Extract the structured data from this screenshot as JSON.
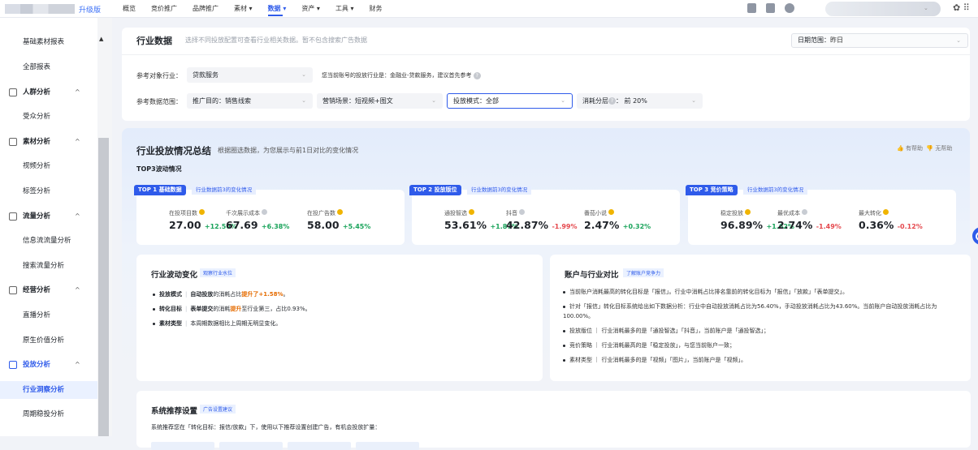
{
  "header": {
    "upgrade_label": "升级版",
    "nav": [
      "概览",
      "竞价推广",
      "品牌推广",
      "素材 ▾",
      "数据 ▾",
      "资产 ▾",
      "工具 ▾",
      "财务"
    ],
    "active_nav_index": 4,
    "dropdown_caret": "▾",
    "settings_glyph": "✿ ⠿"
  },
  "sidebar": {
    "collapse_caret": "▲",
    "group_caret": "^",
    "items": [
      {
        "type": "item",
        "label": "基础素材报表"
      },
      {
        "type": "item",
        "label": "全部报表"
      },
      {
        "type": "group",
        "label": "人群分析",
        "icon": "people-icon"
      },
      {
        "type": "item",
        "label": "受众分析"
      },
      {
        "type": "group",
        "label": "素材分析",
        "icon": "image-icon"
      },
      {
        "type": "item",
        "label": "视频分析"
      },
      {
        "type": "item",
        "label": "标签分析"
      },
      {
        "type": "group",
        "label": "流量分析",
        "icon": "flow-icon"
      },
      {
        "type": "item",
        "label": "信息流流量分析"
      },
      {
        "type": "item",
        "label": "搜索流量分析"
      },
      {
        "type": "group",
        "label": "经营分析",
        "icon": "chart-icon"
      },
      {
        "type": "item",
        "label": "直播分析"
      },
      {
        "type": "item",
        "label": "原生价值分析"
      },
      {
        "type": "group",
        "label": "投放分析",
        "icon": "delivery-icon",
        "active": true
      },
      {
        "type": "item",
        "label": "行业洞察分析",
        "active": true
      },
      {
        "type": "item",
        "label": "周期稳投分析"
      }
    ]
  },
  "industry": {
    "title": "行业数据",
    "subtitle": "选择不同投放配置可查看行业相关数据。暂不包含搜索广告数据",
    "date_label": "日期范围：",
    "date_value": "昨日",
    "ref_industry_label": "参考对象行业：",
    "ref_industry_value": "贷款服务",
    "ref_note": "您当前账号的投放行业是：金融业-贷款服务，建议首先参考",
    "scope_label": "参考数据范围：",
    "goal_label": "推广目的：",
    "goal_value": "销售线索",
    "scene_label": "营销场景：",
    "scene_value": "短视频+图文",
    "mode_label": "投放模式：",
    "mode_value": "全部",
    "tier_label": "消耗分层",
    "tier_value": "：  前 20%",
    "caret": "⌄"
  },
  "summary": {
    "title": "行业投放情况总结",
    "subtitle": "根据圈选数据，为您展示与前1日对比的变化情况",
    "helpful": "👍 有帮助",
    "unhelpful": "👎 无帮助",
    "top3_heading": "TOP3波动情况",
    "cards": [
      {
        "tag": "TOP 1 基础数据",
        "tag_sub": "行业数据前3的变化情况",
        "metrics": [
          {
            "label": "在投项目数",
            "value": "27.00",
            "change": "+12.50%",
            "dir": "up",
            "star": true
          },
          {
            "label": "千次展示成本",
            "value": "67.69",
            "change": "+6.38%",
            "dir": "up",
            "star": false
          },
          {
            "label": "在投广告数",
            "value": "58.00",
            "change": "+5.45%",
            "dir": "up",
            "star": true
          }
        ]
      },
      {
        "tag": "TOP 2 投放版位",
        "tag_sub": "行业数据前3的变化情况",
        "metrics": [
          {
            "label": "通投智选",
            "value": "53.61%",
            "change": "+1.87%",
            "dir": "up",
            "star": true
          },
          {
            "label": "抖音",
            "value": "42.87%",
            "change": "-1.99%",
            "dir": "down",
            "star": false
          },
          {
            "label": "番茄小说",
            "value": "2.47%",
            "change": "+0.32%",
            "dir": "up",
            "star": true
          }
        ]
      },
      {
        "tag": "TOP 3 竞价策略",
        "tag_sub": "行业数据前3的变化情况",
        "metrics": [
          {
            "label": "稳定投放",
            "value": "96.89%",
            "change": "+1.62%",
            "dir": "up",
            "star": true
          },
          {
            "label": "最优成本",
            "value": "2.74%",
            "change": "-1.49%",
            "dir": "down",
            "star": false
          },
          {
            "label": "最大转化",
            "value": "0.36%",
            "change": "-0.12%",
            "dir": "down",
            "star": true
          }
        ]
      }
    ]
  },
  "fluctuation": {
    "title": "行业波动变化",
    "tag": "观察行业水位",
    "lines": [
      {
        "key": "投放模式",
        "pre": "自动投放",
        "mid": "的消耗占比",
        "hl": "提升了+1.58%",
        "post": "。"
      },
      {
        "key": "转化目标",
        "pre": "表单提交",
        "mid": "的消耗",
        "hl": "提升",
        "post": "至行业第三，占比0.93%。"
      },
      {
        "key": "素材类型",
        "pre": "",
        "mid": "本周期数据相比上周期无明显变化。",
        "hl": "",
        "post": ""
      }
    ]
  },
  "compare": {
    "title": "账户与行业对比",
    "tag": "了解账户竞争力",
    "lines": [
      "当前账户消耗最高的转化目标是「报信」。行业中消耗占比排名靠前的转化目标为「报信」「放款」「表单提交」。",
      "针对「报信」转化目标系统给出如下数据分析：行业中自动投放消耗占比为56.40%，手动投放消耗占比为43.60%。当前账户自动投放消耗占比为100.00%。",
      "投放版位 ｜ 行业消耗最多的是「通投智选」「抖音」，当前账户是「通投智选」；",
      "竞价策略 ｜ 行业消耗最高的是「稳定投放」，与您当前账户一致；",
      "素材类型 ｜ 行业消耗最多的是「视频」「图片」，当前账户是「视频」。"
    ]
  },
  "recommend": {
    "title": "系统推荐设置",
    "tag": "广告设置建议",
    "line": "系统推荐您在「转化目标：报信/放款」下，使用以下推荐设置创建广告，有机会投放扩量："
  }
}
